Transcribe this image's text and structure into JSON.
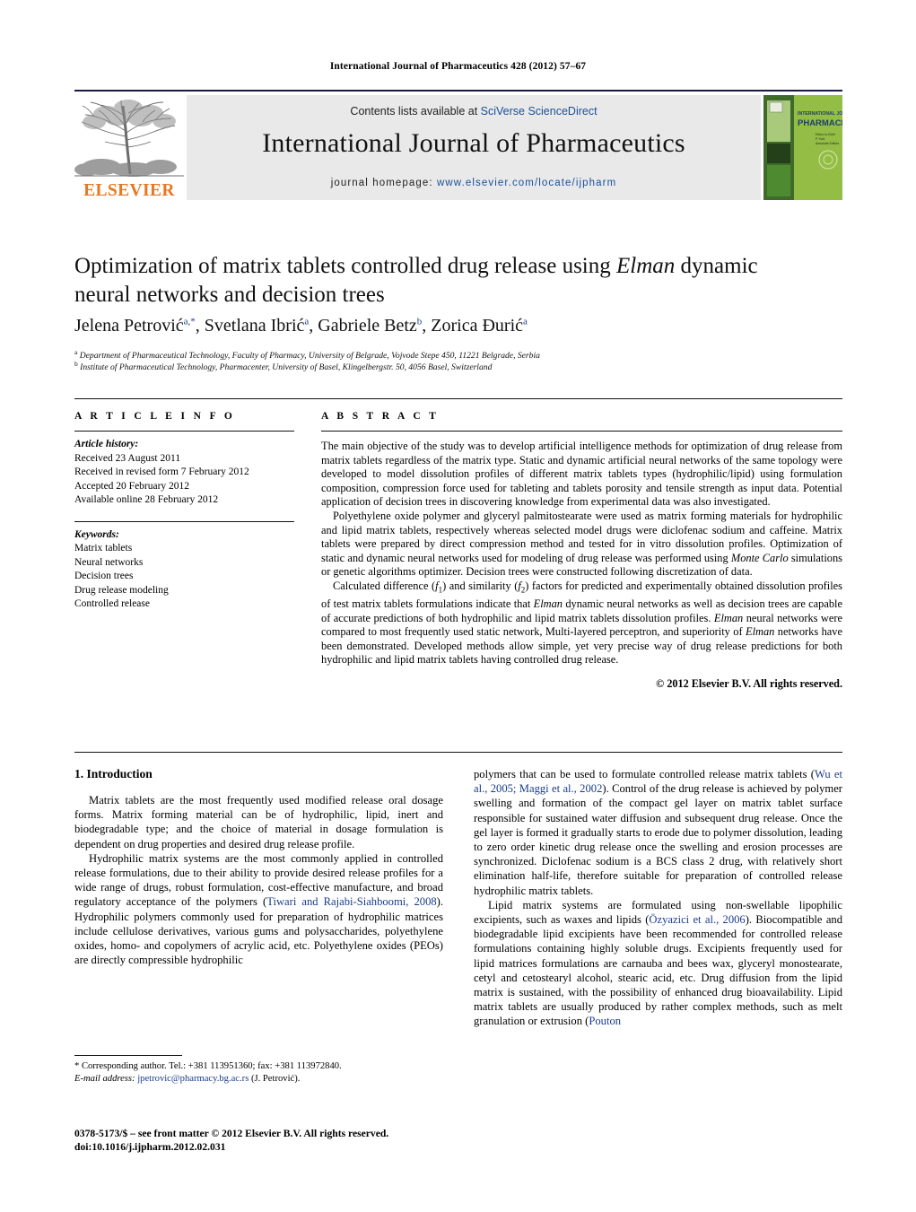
{
  "running_head": "International Journal of Pharmaceutics 428 (2012) 57–67",
  "masthead": {
    "contents_prefix": "Contents lists available at ",
    "contents_link": "SciVerse ScienceDirect",
    "journal_title": "International Journal of Pharmaceutics",
    "homepage_prefix": "journal homepage: ",
    "homepage_url": "www.elsevier.com/locate/ijpharm",
    "publisher": "ELSEVIER",
    "cover_title_line1": "INTERNATIONAL JOURNAL OF",
    "cover_title_line2": "PHARMACEUTICS"
  },
  "article": {
    "title_part1": "Optimization of matrix tablets controlled drug release using ",
    "title_italic": "Elman",
    "title_part2": " dynamic neural networks and decision trees",
    "authors": [
      {
        "name": "Jelena Petrović",
        "marks": "a,*"
      },
      {
        "name": "Svetlana Ibrić",
        "marks": "a"
      },
      {
        "name": "Gabriele Betz",
        "marks": "b"
      },
      {
        "name": "Zorica Đurić",
        "marks": "a"
      }
    ],
    "affiliations": [
      {
        "mark": "a",
        "text": "Department of Pharmaceutical Technology, Faculty of Pharmacy, University of Belgrade, Vojvode Stepe 450, 11221 Belgrade, Serbia"
      },
      {
        "mark": "b",
        "text": "Institute of Pharmaceutical Technology, Pharmacenter, University of Basel, Klingelbergstr. 50, 4056 Basel, Switzerland"
      }
    ]
  },
  "article_info": {
    "heading": "A R T I C L E   I N F O",
    "history_label": "Article history:",
    "history": [
      "Received 23 August 2011",
      "Received in revised form 7 February 2012",
      "Accepted 20 February 2012",
      "Available online 28 February 2012"
    ],
    "keywords_label": "Keywords:",
    "keywords": [
      "Matrix tablets",
      "Neural networks",
      "Decision trees",
      "Drug release modeling",
      "Controlled release"
    ]
  },
  "abstract": {
    "heading": "A B S T R A C T",
    "paragraphs": [
      "The main objective of the study was to develop artificial intelligence methods for optimization of drug release from matrix tablets regardless of the matrix type. Static and dynamic artificial neural networks of the same topology were developed to model dissolution profiles of different matrix tablets types (hydrophilic/lipid) using formulation composition, compression force used for tableting and tablets porosity and tensile strength as input data. Potential application of decision trees in discovering knowledge from experimental data was also investigated."
    ],
    "paragraph2_pre": "Polyethylene oxide polymer and glyceryl palmitostearate were used as matrix forming materials for hydrophilic and lipid matrix tablets, respectively whereas selected model drugs were diclofenac sodium and caffeine. Matrix tablets were prepared by direct compression method and tested for in vitro dissolution profiles. Optimization of static and dynamic neural networks used for modeling of drug release was performed using ",
    "paragraph2_em": "Monte Carlo",
    "paragraph2_post": " simulations or genetic algorithms optimizer. Decision trees were constructed following discretization of data.",
    "paragraph3_a": "Calculated difference (",
    "paragraph3_f1": "f",
    "paragraph3_f1sub": "1",
    "paragraph3_b": ") and similarity (",
    "paragraph3_f2": "f",
    "paragraph3_f2sub": "2",
    "paragraph3_c": ") factors for predicted and experimentally obtained dissolution profiles of test matrix tablets formulations indicate that ",
    "paragraph3_em1": "Elman",
    "paragraph3_d": " dynamic neural networks as well as decision trees are capable of accurate predictions of both hydrophilic and lipid matrix tablets dissolution profiles. ",
    "paragraph3_em2": "Elman",
    "paragraph3_e": " neural networks were compared to most frequently used static network, Multi-layered perceptron, and superiority of ",
    "paragraph3_em3": "Elman",
    "paragraph3_f": " networks have been demonstrated. Developed methods allow simple, yet very precise way of drug release predictions for both hydrophilic and lipid matrix tablets having controlled drug release.",
    "copyright": "© 2012 Elsevier B.V. All rights reserved."
  },
  "body": {
    "section_number_title": "1.  Introduction",
    "left_column": [
      "Matrix tablets are the most frequently used modified release oral dosage forms. Matrix forming material can be of hydrophilic, lipid, inert and biodegradable type; and the choice of material in dosage formulation is dependent on drug properties and desired drug release profile.",
      "Hydrophilic matrix systems are the most commonly applied in controlled release formulations, due to their ability to provide desired release profiles for a wide range of drugs, robust formulation, cost-effective manufacture, and broad regulatory acceptance of the polymers (",
      "Tiwari and Rajabi-Siahboomi, 2008",
      "). Hydrophilic polymers commonly used for preparation of hydrophilic matrices include cellulose derivatives, various gums and polysaccharides, polyethylene oxides, homo- and copolymers of acrylic acid, etc. Polyethylene oxides (PEOs) are directly compressible hydrophilic"
    ],
    "right_column": {
      "p1_pre": "polymers that can be used to formulate controlled release matrix tablets (",
      "p1_ref": "Wu et al., 2005; Maggi et al., 2002",
      "p1_post": "). Control of the drug release is achieved by polymer swelling and formation of the compact gel layer on matrix tablet surface responsible for sustained water diffusion and subsequent drug release. Once the gel layer is formed it gradually starts to erode due to polymer dissolution, leading to zero order kinetic drug release once the swelling and erosion processes are synchronized. Diclofenac sodium is a BCS class 2 drug, with relatively short elimination half-life, therefore suitable for preparation of controlled release hydrophilic matrix tablets.",
      "p2_pre": "Lipid matrix systems are formulated using non-swellable lipophilic excipients, such as waxes and lipids (",
      "p2_ref": "Özyazici et al., 2006",
      "p2_mid": "). Biocompatible and biodegradable lipid excipients have been recommended for controlled release formulations containing highly soluble drugs. Excipients frequently used for lipid matrices formulations are carnauba and bees wax, glyceryl monostearate, cetyl and cetostearyl alcohol, stearic acid, etc. Drug diffusion from the lipid matrix is sustained, with the possibility of enhanced drug bioavailability. Lipid matrix tablets are usually produced by rather complex methods, such as melt granulation or extrusion (",
      "p2_ref2": "Pouton"
    }
  },
  "footnotes": {
    "corresponding": "* Corresponding author. Tel.: +381 113951360; fax: +381 113972840.",
    "email_label": "E-mail address:",
    "email": "jpetrovic@pharmacy.bg.ac.rs",
    "email_suffix": " (J. Petrović).",
    "imprint_line1": "0378-5173/$ – see front matter © 2012 Elsevier B.V. All rights reserved.",
    "imprint_line2": "doi:10.1016/j.ijpharm.2012.02.031"
  },
  "colors": {
    "link": "#1a4f9c",
    "reference": "#1a3c8c",
    "elsevier_orange": "#E87722",
    "cover_green": "#8ab33a",
    "masthead_bg": "#e9e9e9"
  }
}
